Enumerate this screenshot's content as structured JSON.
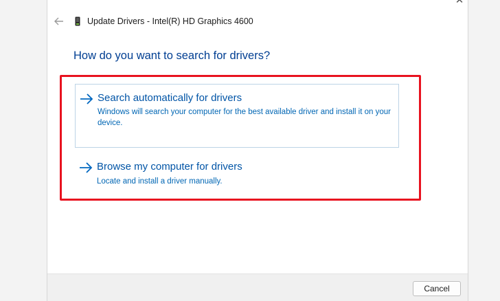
{
  "window": {
    "title": "Update Drivers - Intel(R) HD Graphics 4600",
    "close_glyph": "✕"
  },
  "main": {
    "heading": "How do you want to search for drivers?",
    "options": [
      {
        "title": "Search automatically for drivers",
        "description": "Windows will search your computer for the best available driver and install it on your device."
      },
      {
        "title": "Browse my computer for drivers",
        "description": "Locate and install a driver manually."
      }
    ]
  },
  "footer": {
    "cancel_label": "Cancel"
  },
  "colors": {
    "heading": "#003e92",
    "option_title": "#0054a6",
    "option_desc": "#0066b4",
    "highlight": "#e8121f"
  },
  "icons": {
    "back": "back-arrow-icon",
    "device": "display-adapter-icon",
    "option_arrow": "right-arrow-icon"
  }
}
